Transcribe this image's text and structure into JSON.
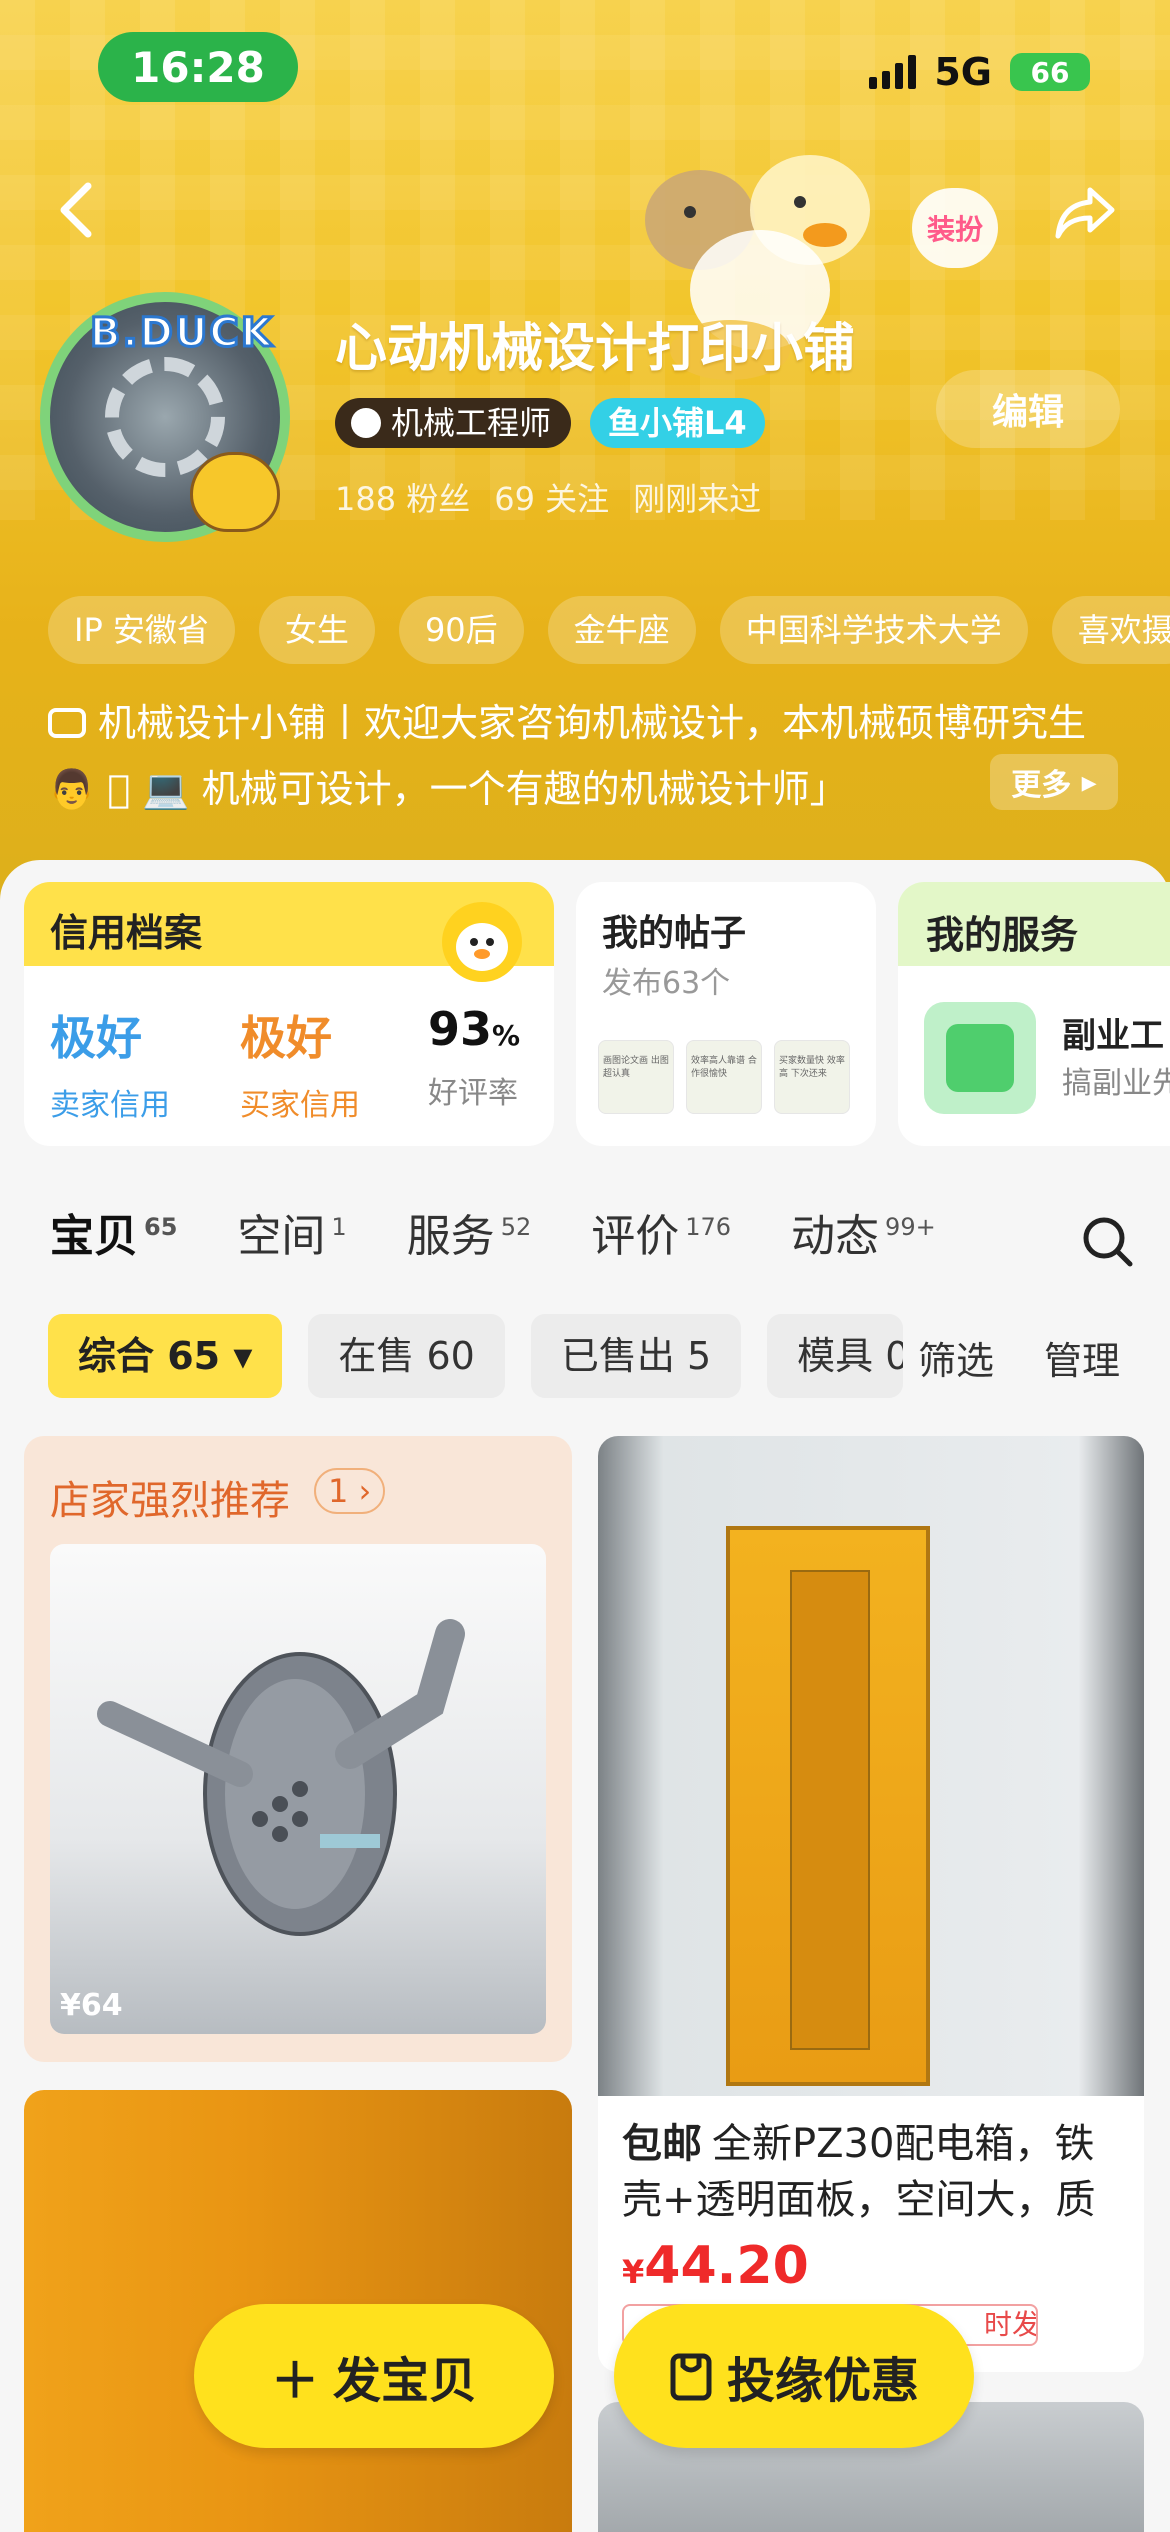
{
  "status": {
    "time": "16:28",
    "network": "5G",
    "battery": "66"
  },
  "header": {
    "dress_up_label": "装扮"
  },
  "profile": {
    "avatar_brand": "B.DUCK",
    "shop_name": "心动机械设计打印小铺",
    "role_tag": "机械工程师",
    "level_tag": "鱼小铺L4",
    "fans": "188 粉丝",
    "following": "69 关注",
    "last_seen": "刚刚来过",
    "edit_label": "编辑",
    "chips": [
      "IP 安徽省",
      "女生",
      "90后",
      "金牛座",
      "中国科学技术大学",
      "喜欢摄"
    ],
    "bio": "机械设计小铺丨欢迎大家咨询机械设计，本机械硕博研究生👨 🏻 💻 机械可设计，一个有趣的机械设计师」",
    "more_label": "更多"
  },
  "cards": {
    "credit": {
      "title": "信用档案",
      "seller_value": "极好",
      "seller_label": "卖家信用",
      "buyer_value": "极好",
      "buyer_label": "买家信用",
      "rate_value": "93",
      "rate_unit": "%",
      "rate_label": "好评率",
      "seller_color": "#3b9de8",
      "buyer_color": "#f08c2a"
    },
    "posts": {
      "title": "我的帖子",
      "subtitle": "发布63个",
      "thumbs": [
        "画图论文画 出图超认真",
        "效率高人靠谱 合作很愉快",
        "买家数量快 效率高 下次还来"
      ]
    },
    "services": {
      "title": "我的服务",
      "line1": "副业工",
      "line2": "搞副业先"
    }
  },
  "tabs": [
    {
      "label": "宝贝",
      "count": "65"
    },
    {
      "label": "空间",
      "count": "1"
    },
    {
      "label": "服务",
      "count": "52"
    },
    {
      "label": "评价",
      "count": "176"
    },
    {
      "label": "动态",
      "count": "99+"
    }
  ],
  "filters": {
    "items": [
      "综合 65 ▾",
      "在售 60",
      "已售出 5",
      "模具 0"
    ],
    "filter_label": "筛选",
    "manage_label": "管理"
  },
  "products": {
    "recommend_title": "店家强烈推荐",
    "recommend_count": "1",
    "recommend_price": "¥64",
    "item2_badge": "包邮",
    "item2_title": "全新PZ30配电箱，铁壳+透明面板，空间大，质",
    "item2_price_symbol": "¥",
    "item2_price": "44.20",
    "item2_ship": "时发货"
  },
  "fab": {
    "post_label": "发宝贝",
    "promo_label": "投缘优惠"
  },
  "colors": {
    "accent_yellow": "#ffe14a",
    "hero_yellow": "#f2c52b",
    "price_red": "#ef2a2a"
  }
}
